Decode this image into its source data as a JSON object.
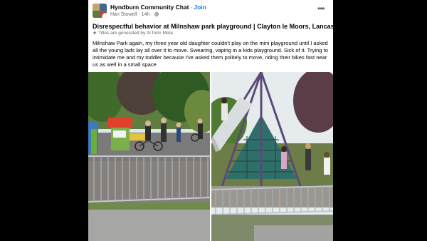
{
  "post": {
    "group_name": "Hyndburn Community Chat",
    "join_label": "Join",
    "author": "Han Stowell",
    "time": "14h",
    "more_label": "•••",
    "title": "Disrespectful behavior at Milnshaw park playground | Clayton le Moors, Lancashire",
    "ai_note": "Titles are generated by AI from Meta",
    "body": "Milnshaw Park again, my three year old daughter couldn't play on the mini playground until I asked all the young lads lay all over it to move. Swearing, vaping in a kids playground. Sick of it. Trying to intimidate me and my toddler because I've asked them politely to move, riding their bikes fast near us as well in a small space"
  },
  "colors": {
    "link": "#1877f2",
    "text": "#050505",
    "secondary": "#65676b"
  },
  "icons": [
    "more-icon",
    "globe-icon",
    "ai-sparkle-icon"
  ],
  "photos": [
    "playground-photo-bikes",
    "playground-photo-climbing-frame"
  ]
}
